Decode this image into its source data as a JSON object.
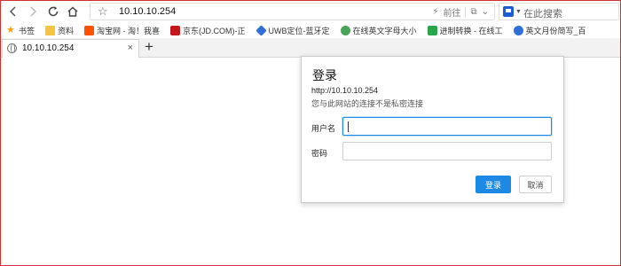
{
  "browser": {
    "address_url": "10.10.10.254",
    "go_label": "前往",
    "search_placeholder": "在此搜索"
  },
  "bookmarks": [
    {
      "label": "书签",
      "icon": "bookmark-star-icon"
    },
    {
      "label": "资料",
      "icon": "folder-icon"
    },
    {
      "label": "淘宝网 - 淘！我喜",
      "icon": "taobao-icon"
    },
    {
      "label": "京东(JD.COM)-正",
      "icon": "jd-icon"
    },
    {
      "label": "UWB定位-蓝牙定",
      "icon": "uwb-icon"
    },
    {
      "label": "在线英文字母大小",
      "icon": "english-tool-icon"
    },
    {
      "label": "进制转换 - 在线工",
      "icon": "converter-icon"
    },
    {
      "label": "英文月份简写_百",
      "icon": "baidu-paw-icon"
    }
  ],
  "tab": {
    "title": "10.10.10.254",
    "close_glyph": "×",
    "new_glyph": "+"
  },
  "auth_dialog": {
    "title": "登录",
    "url": "http://10.10.10.254",
    "warning": "您与此网站的连接不是私密连接",
    "username_label": "用户名",
    "username_value": "",
    "password_label": "密码",
    "password_value": "",
    "login_button": "登录",
    "cancel_button": "取消"
  },
  "colors": {
    "primary_button": "#1e88e5",
    "window_border": "#d32f2f"
  }
}
